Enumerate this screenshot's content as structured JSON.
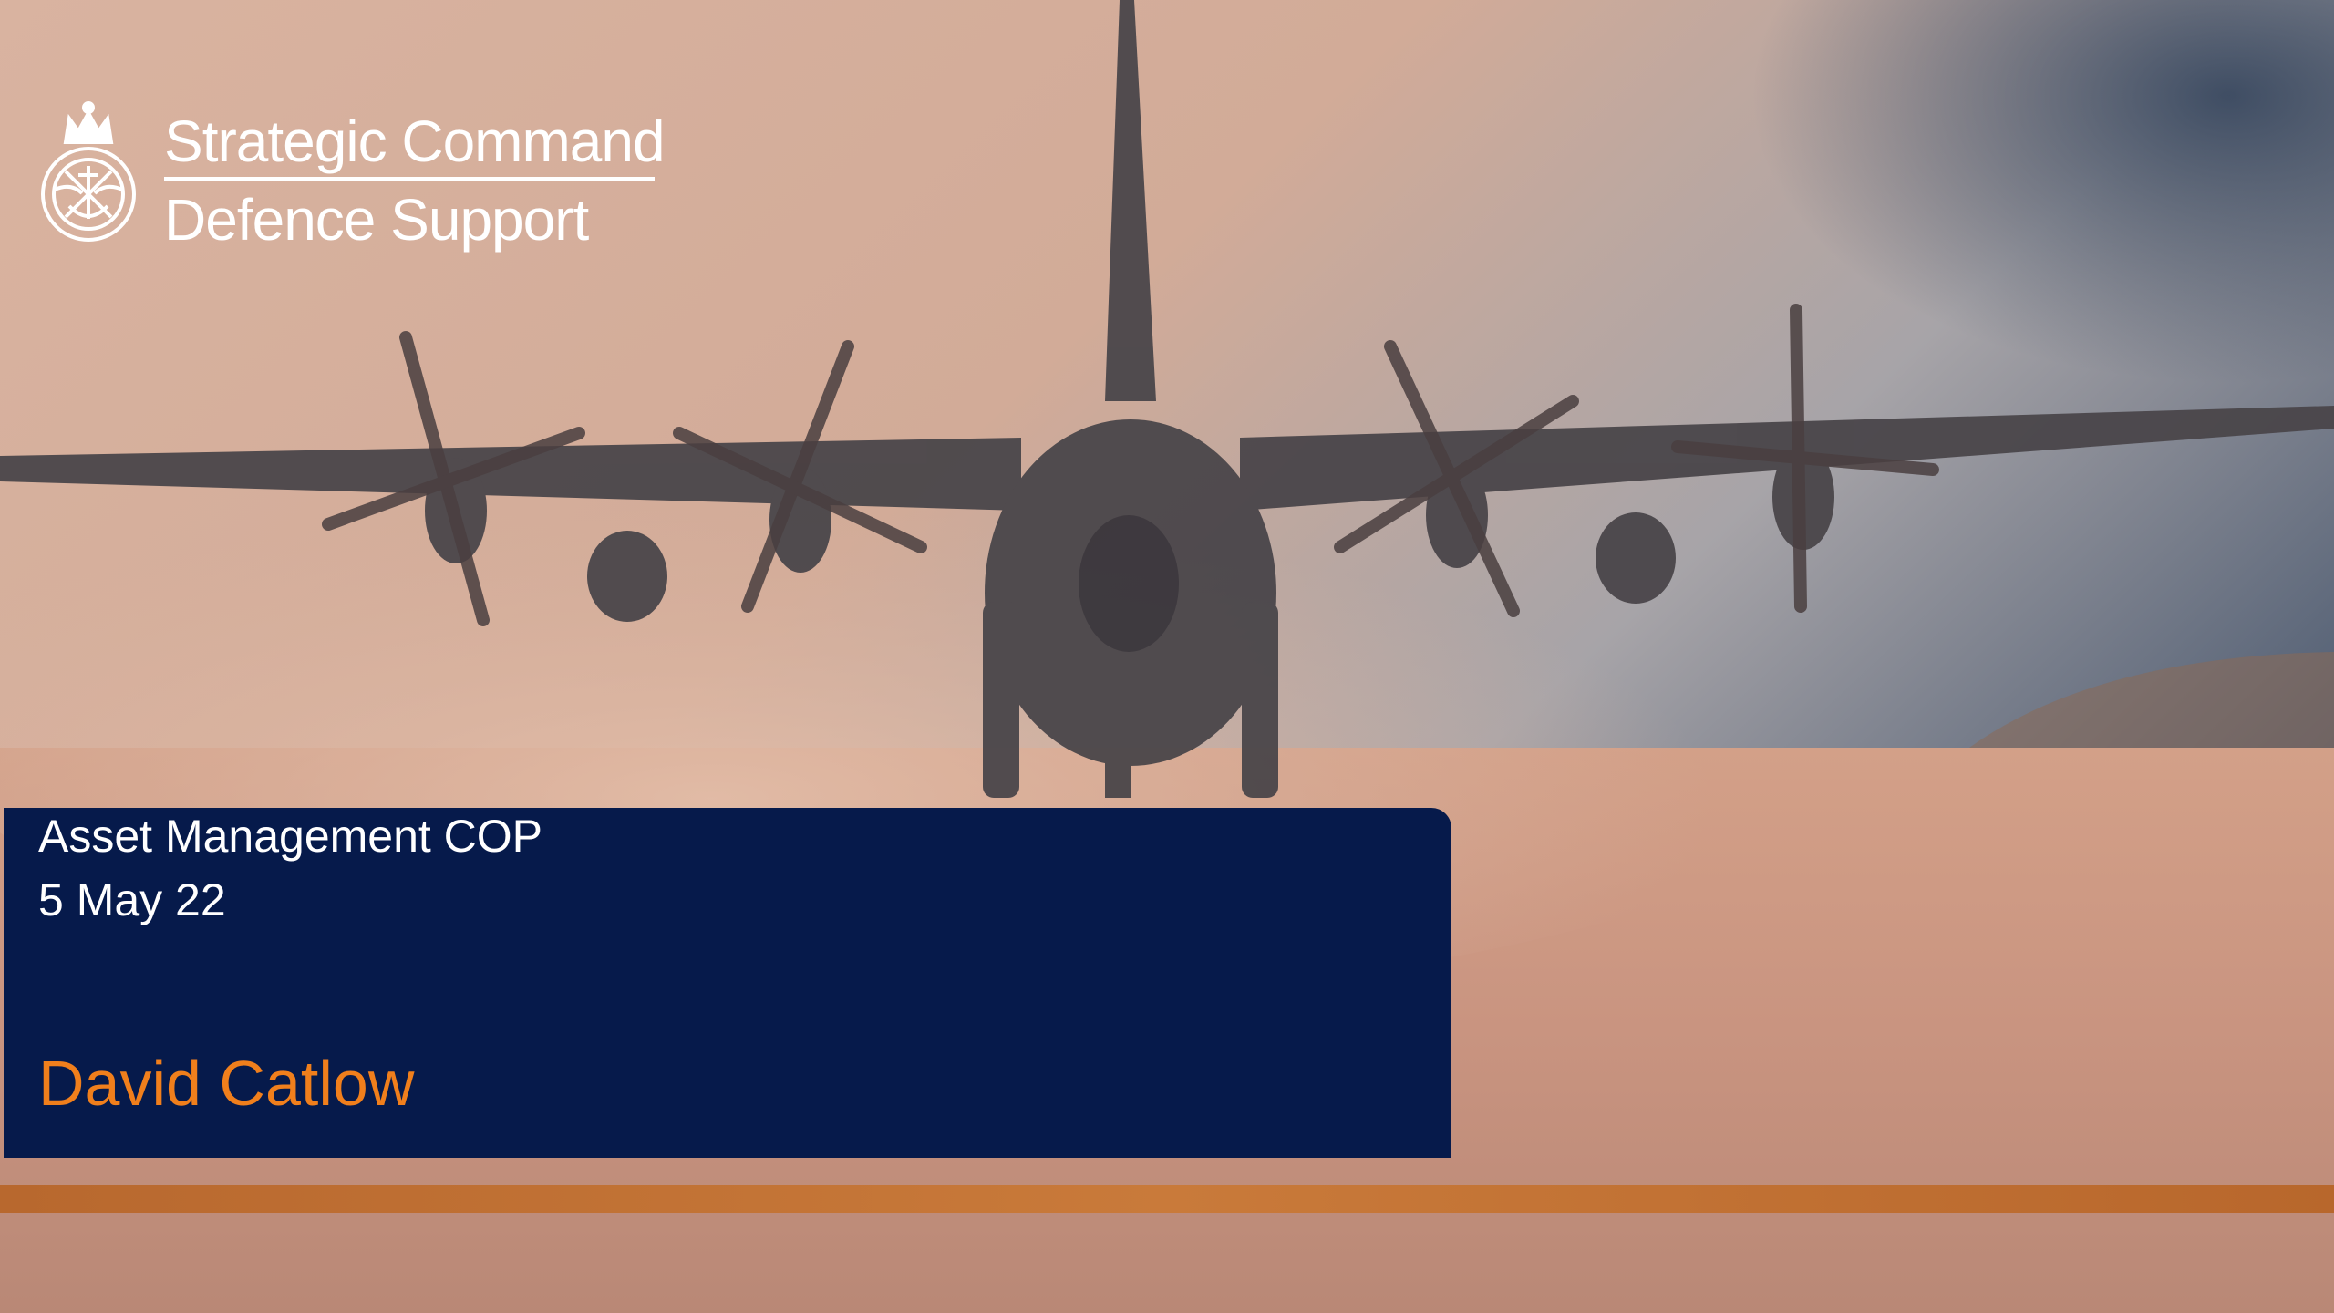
{
  "brand": {
    "line1": "Strategic Command",
    "line2": "Defence Support",
    "crest_icon": "royal-crest-icon",
    "color": "#ffffff"
  },
  "title_panel": {
    "event_title": "Asset Management COP",
    "event_date": "5 May 22",
    "presenter": "David Catlow",
    "background_color": "#061a4b",
    "presenter_color": "#f07f1c"
  },
  "footer": {
    "stripe_color": "#c0702f"
  },
  "background": {
    "subject": "aircraft-photo"
  }
}
